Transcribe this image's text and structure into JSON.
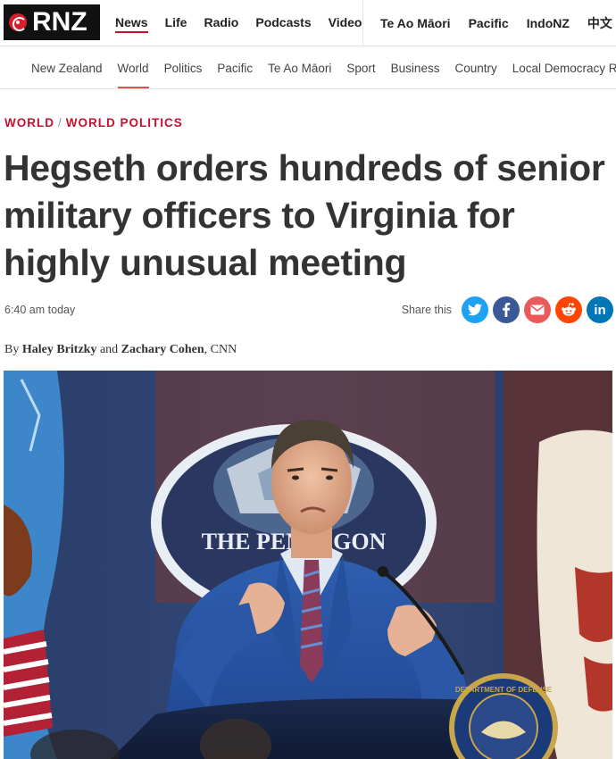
{
  "brand": {
    "logo_text": "RNZ"
  },
  "main_nav": {
    "primary": [
      "News",
      "Life",
      "Radio",
      "Podcasts",
      "Video"
    ],
    "secondary": [
      "Te Ao Māori",
      "Pacific",
      "IndoNZ",
      "中文"
    ],
    "active": "News"
  },
  "sub_nav": {
    "items": [
      "New Zealand",
      "World",
      "Politics",
      "Pacific",
      "Te Ao Māori",
      "Sport",
      "Business",
      "Country",
      "Local Democracy Re"
    ],
    "active": "World"
  },
  "breadcrumb": {
    "section": "WORLD",
    "subsection": "WORLD POLITICS"
  },
  "article": {
    "headline": "Hegseth orders hundreds of senior military officers to Virginia for highly unusual meeting",
    "timestamp": "6:40 am today",
    "share_label": "Share this",
    "byline_prefix": "By",
    "author1": "Haley Britzky",
    "byline_and": "and",
    "author2": "Zachary Cohen",
    "byline_source": ", CNN"
  },
  "share_buttons": [
    "twitter-icon",
    "facebook-icon",
    "email-icon",
    "reddit-icon",
    "linkedin-icon"
  ],
  "colors": {
    "accent": "#c8102e",
    "twitter": "#1da1f2",
    "facebook": "#3b5998",
    "email": "#ea5a5a",
    "reddit": "#ff4500",
    "linkedin": "#0077b5"
  },
  "hero_image": {
    "podium_seal_text": "DEPARTMENT OF DEFENSE",
    "backdrop_text": "THE PENTAGON"
  }
}
